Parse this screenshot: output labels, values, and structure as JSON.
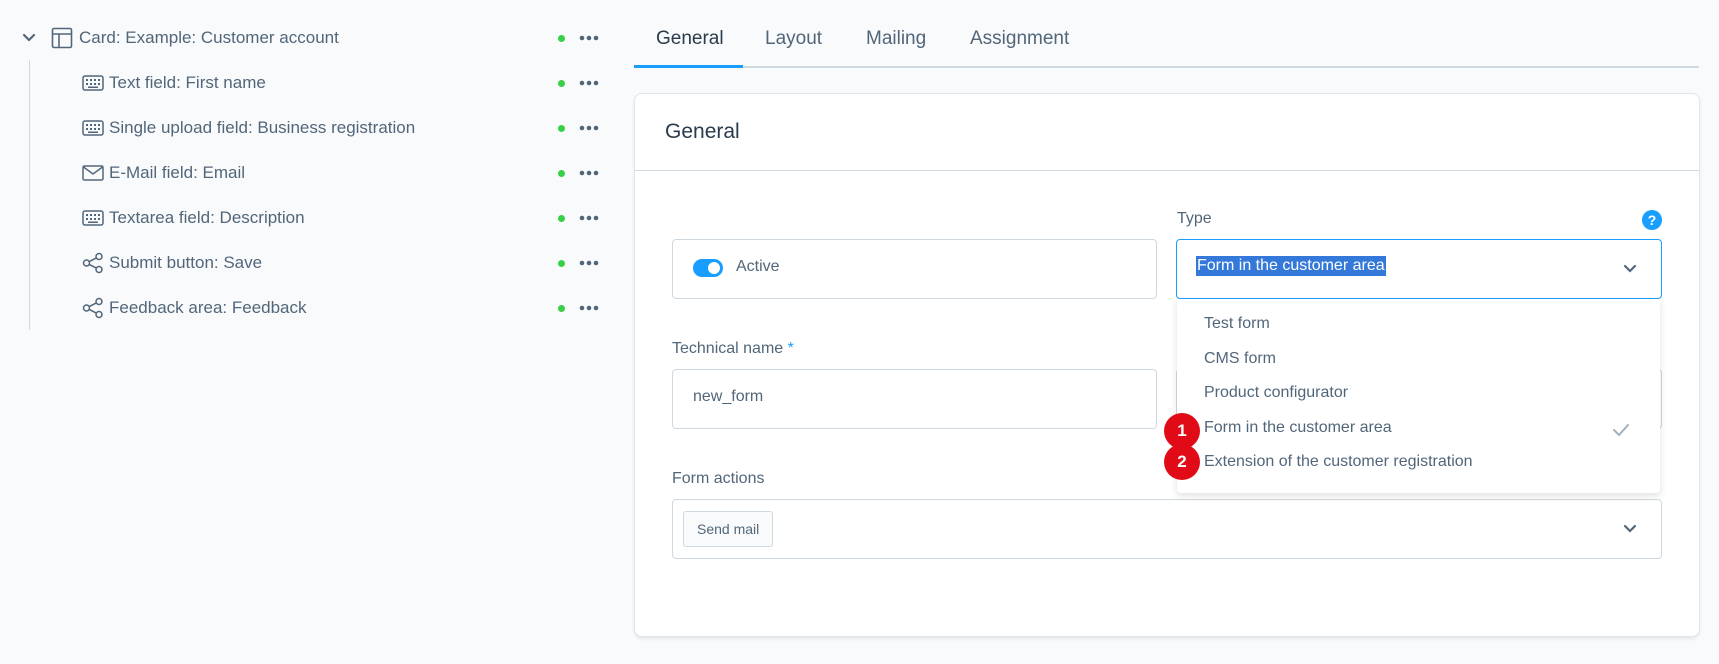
{
  "tree": {
    "root": {
      "label": "Card: Example: Customer account",
      "icon": "layout-icon"
    },
    "children": [
      {
        "label": "Text field: First name",
        "icon": "keyboard-icon"
      },
      {
        "label": "Single upload field: Business registration",
        "icon": "keyboard-icon"
      },
      {
        "label": "E-Mail field: Email",
        "icon": "envelope-icon"
      },
      {
        "label": "Textarea field: Description",
        "icon": "keyboard-icon"
      },
      {
        "label": "Submit button: Save",
        "icon": "share-icon"
      },
      {
        "label": "Feedback area: Feedback",
        "icon": "share-icon"
      }
    ],
    "status_color": "#37d046"
  },
  "tabs": [
    {
      "label": "General",
      "active": true
    },
    {
      "label": "Layout",
      "active": false
    },
    {
      "label": "Mailing",
      "active": false
    },
    {
      "label": "Assignment",
      "active": false
    }
  ],
  "card": {
    "title": "General",
    "active_label": "Active",
    "type": {
      "label": "Type",
      "help": "?",
      "selected": "Form in the customer area",
      "options": [
        {
          "label": "Test form",
          "selected": false
        },
        {
          "label": "CMS form",
          "selected": false
        },
        {
          "label": "Product configurator",
          "selected": false
        },
        {
          "label": "Form in the customer area",
          "selected": true
        },
        {
          "label": "Extension of the customer registration",
          "selected": false
        }
      ]
    },
    "technical_name": {
      "label": "Technical name",
      "required_mark": "*",
      "value": "new_form"
    },
    "form_actions": {
      "label": "Form actions",
      "chip": "Send mail"
    }
  },
  "markers": [
    "1",
    "2"
  ],
  "colors": {
    "accent": "#189eff",
    "text": "#52667a",
    "marker": "#e10b17"
  }
}
